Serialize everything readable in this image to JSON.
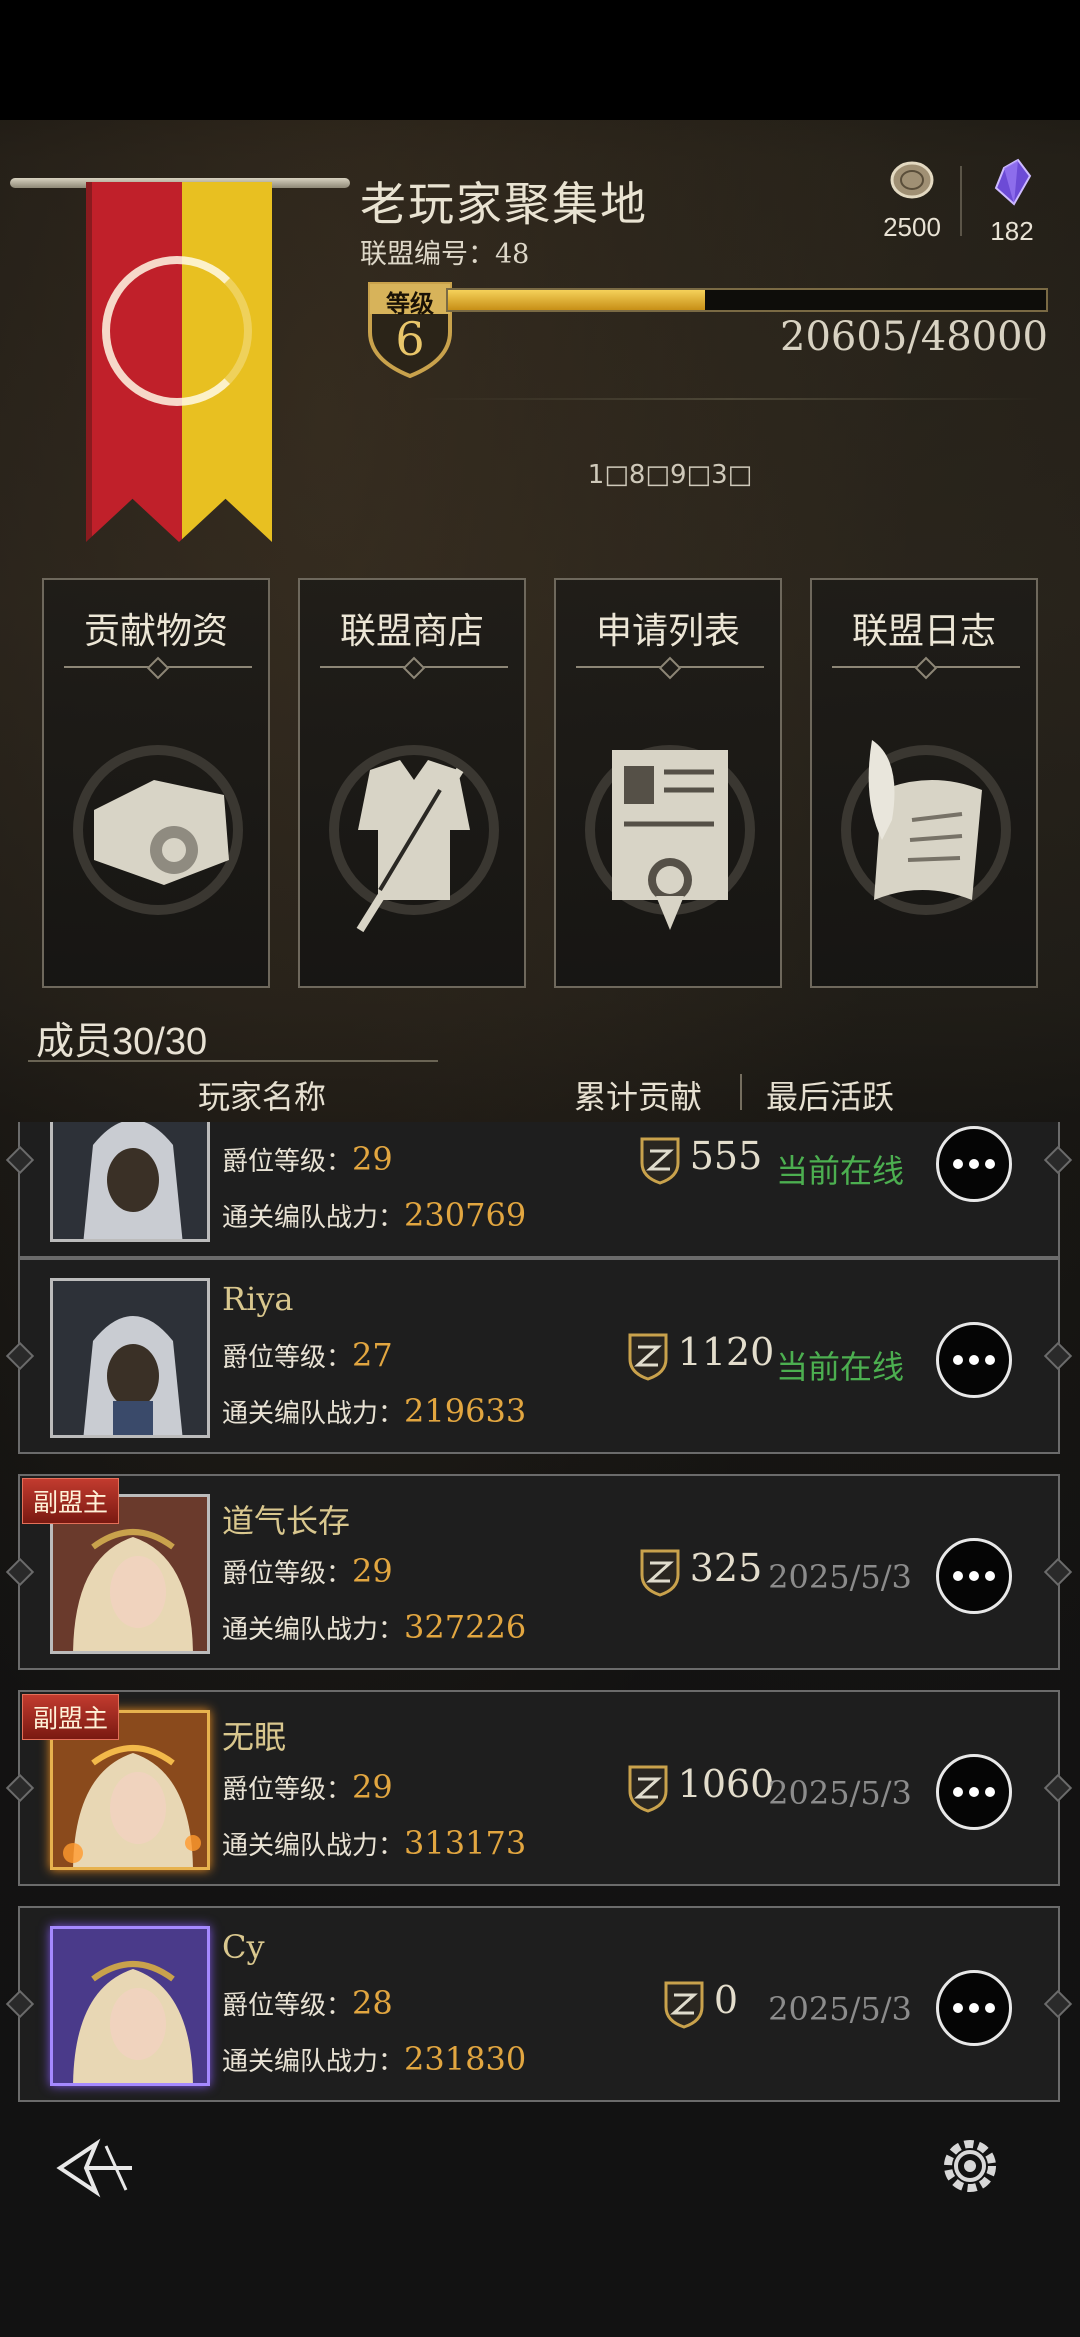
{
  "alliance": {
    "name": "老玩家聚集地",
    "id_label": "联盟编号：48",
    "level_title": "等级",
    "level": "6",
    "xp_text": "20605/48000",
    "xp_current": 20605,
    "xp_max": 48000
  },
  "resources": {
    "coin": "2500",
    "gem": "182"
  },
  "notice": "1□8□9□3□",
  "actions": [
    {
      "label": "贡献物资",
      "icon": "supplies-icon"
    },
    {
      "label": "联盟商店",
      "icon": "armor-sword-icon"
    },
    {
      "label": "申请列表",
      "icon": "application-document-icon"
    },
    {
      "label": "联盟日志",
      "icon": "quill-scroll-icon"
    }
  ],
  "members_header": {
    "count": "成员30/30",
    "col_name": "玩家名称",
    "col_contrib": "累计贡献",
    "col_last": "最后活跃"
  },
  "members": [
    {
      "name": "",
      "rank_label": "爵位等级：",
      "rank": "29",
      "power_label": "通关编队战力：",
      "power": "230769",
      "contrib": "555",
      "last": "当前在线",
      "online": true,
      "badge": ""
    },
    {
      "name": "Riya",
      "rank_label": "爵位等级：",
      "rank": "27",
      "power_label": "通关编队战力：",
      "power": "219633",
      "contrib": "1120",
      "last": "当前在线",
      "online": true,
      "badge": ""
    },
    {
      "name": "道气长存",
      "rank_label": "爵位等级：",
      "rank": "29",
      "power_label": "通关编队战力：",
      "power": "327226",
      "contrib": "325",
      "last": "2025/5/3",
      "online": false,
      "badge": "副盟主"
    },
    {
      "name": "无眠",
      "rank_label": "爵位等级：",
      "rank": "29",
      "power_label": "通关编队战力：",
      "power": "313173",
      "contrib": "1060",
      "last": "2025/5/3",
      "online": false,
      "badge": "副盟主"
    },
    {
      "name": "Cy",
      "rank_label": "爵位等级：",
      "rank": "28",
      "power_label": "通关编队战力：",
      "power": "231830",
      "contrib": "0",
      "last": "2025/5/3",
      "online": false,
      "badge": ""
    }
  ],
  "colors": {
    "online": "#4caf50",
    "accent_gold": "#e2a640",
    "banner_red": "#c0202a",
    "banner_yellow": "#e8c021"
  }
}
